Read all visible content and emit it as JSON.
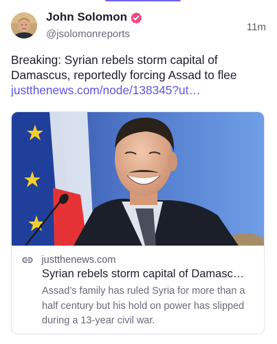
{
  "post": {
    "author_name": "John Solomon",
    "handle": "@jsolomonreports",
    "time": "11m",
    "text": "Breaking: Syrian rebels storm capital of Damascus, reportedly forcing Assad to flee",
    "link_text": "justthenews.com/node/138345?ut…"
  },
  "link_card": {
    "domain": "justthenews.com",
    "title": "Syrian rebels storm capital of Damasc…",
    "description": "Assad’s family has ruled Syria for more than a half century but his hold on power has slipped during a 13-year civil war."
  },
  "icons": {
    "verified": "verified-badge-icon",
    "link": "link-icon"
  },
  "colors": {
    "accent": "#5c55e0",
    "verified_badge": "#ee4a82",
    "text": "#1f1c29",
    "muted": "#6b6878"
  }
}
